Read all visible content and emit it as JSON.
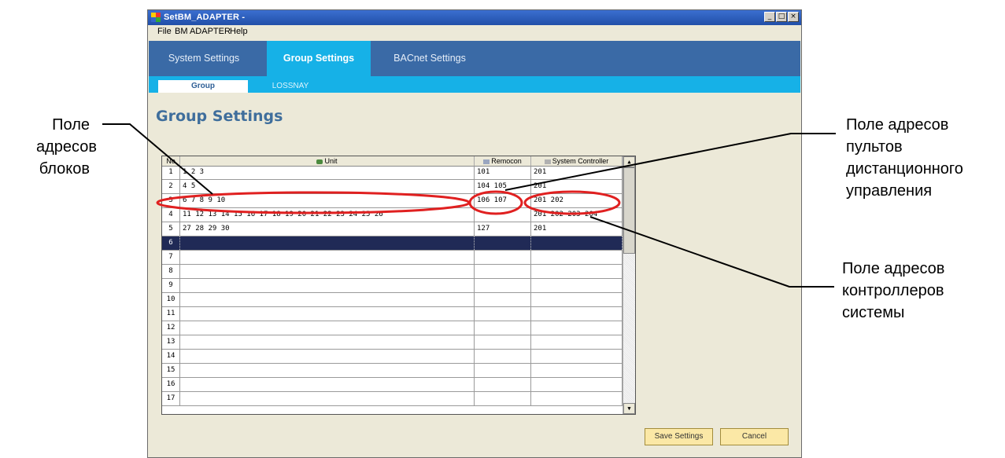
{
  "window": {
    "title": "SetBM_ADAPTER -",
    "controls": {
      "minimize": "_",
      "maximize": "□",
      "close": "×"
    }
  },
  "menu": [
    "File",
    "BM ADAPTER",
    "Help"
  ],
  "tabs": [
    {
      "label": "System Settings",
      "active": false
    },
    {
      "label": "Group Settings",
      "active": true
    },
    {
      "label": "BACnet Settings",
      "active": false
    }
  ],
  "subtabs": [
    {
      "label": "Group",
      "active": true
    },
    {
      "label": "LOSSNAY",
      "active": false
    }
  ],
  "page_title": "Group Settings",
  "grid": {
    "headers": {
      "no": "No",
      "unit": "Unit",
      "remocon": "Remocon",
      "system_controller": "System Controller"
    },
    "rows": [
      {
        "no": "1",
        "unit": "1  2  3",
        "remocon": "101",
        "sc": "201"
      },
      {
        "no": "2",
        "unit": "4  5",
        "remocon": "104  105",
        "sc": "201"
      },
      {
        "no": "3",
        "unit": "6  7  8  9  10",
        "remocon": "106  107",
        "sc": "201  202"
      },
      {
        "no": "4",
        "unit": "11  12  13  14  15  16  17  18  19  20  21  22  23  24  25  26",
        "remocon": "",
        "sc": "201  202  203  204"
      },
      {
        "no": "5",
        "unit": "27  28  29  30",
        "remocon": "127",
        "sc": "201"
      },
      {
        "no": "6",
        "unit": "",
        "remocon": "",
        "sc": "",
        "selected": true
      },
      {
        "no": "7",
        "unit": "",
        "remocon": "",
        "sc": ""
      },
      {
        "no": "8",
        "unit": "",
        "remocon": "",
        "sc": ""
      },
      {
        "no": "9",
        "unit": "",
        "remocon": "",
        "sc": ""
      },
      {
        "no": "10",
        "unit": "",
        "remocon": "",
        "sc": ""
      },
      {
        "no": "11",
        "unit": "",
        "remocon": "",
        "sc": ""
      },
      {
        "no": "12",
        "unit": "",
        "remocon": "",
        "sc": ""
      },
      {
        "no": "13",
        "unit": "",
        "remocon": "",
        "sc": ""
      },
      {
        "no": "14",
        "unit": "",
        "remocon": "",
        "sc": ""
      },
      {
        "no": "15",
        "unit": "",
        "remocon": "",
        "sc": ""
      },
      {
        "no": "16",
        "unit": "",
        "remocon": "",
        "sc": ""
      },
      {
        "no": "17",
        "unit": "",
        "remocon": "",
        "sc": ""
      }
    ],
    "scroll": {
      "up": "▲",
      "down": "▼"
    }
  },
  "buttons": {
    "save": "Save Settings",
    "cancel": "Cancel"
  },
  "annotations": {
    "unit_field": [
      "Поле",
      "адресов",
      "блоков"
    ],
    "remocon_field": [
      "Поле адресов",
      "пультов",
      "дистанционного",
      "управления"
    ],
    "sc_field": [
      "Поле адресов",
      "контроллеров",
      "системы"
    ]
  },
  "colors": {
    "tab_bar": "#3a6aa6",
    "active_tab": "#16b1e7",
    "selected_row": "#202a56",
    "highlight_ellipse": "#e02020",
    "button_fill": "#fbe8a6"
  }
}
